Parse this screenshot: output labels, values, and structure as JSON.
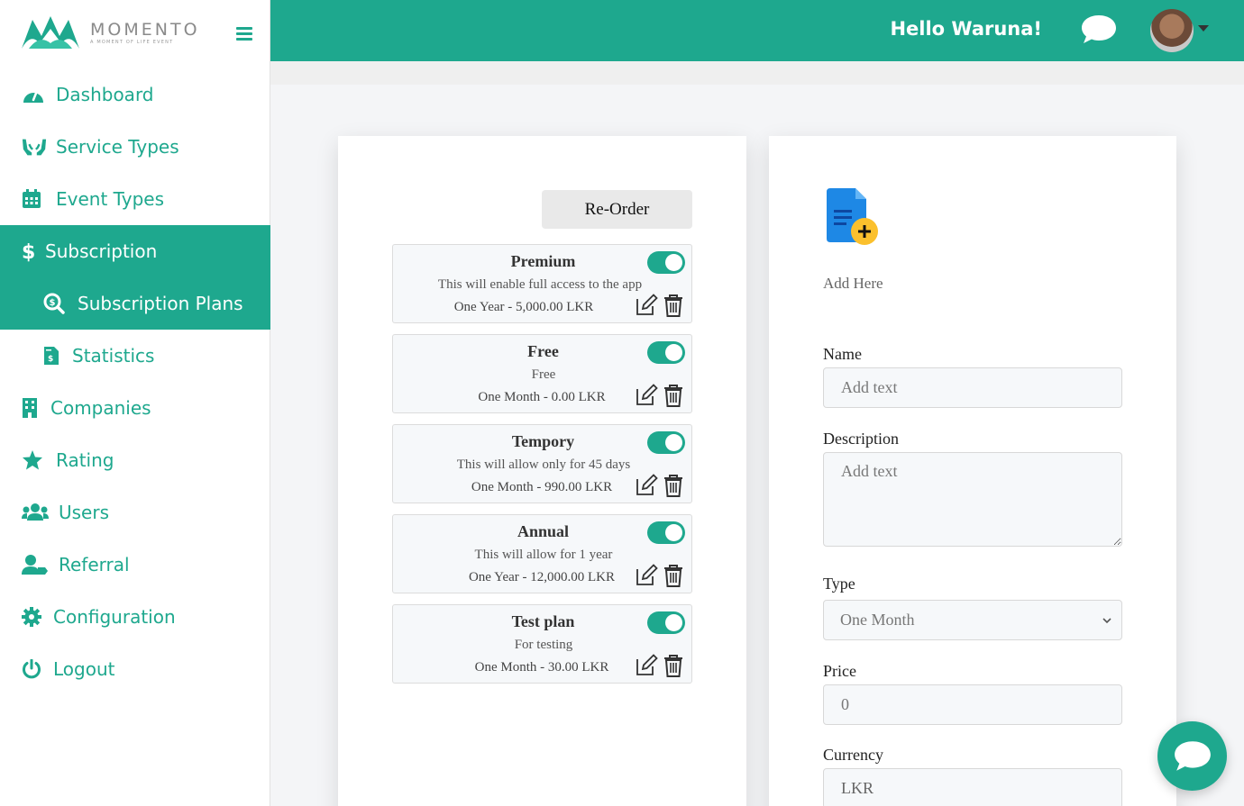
{
  "brand": {
    "name": "MOMENTO",
    "tagline": "A MOMENT OF LIFE EVENT"
  },
  "header": {
    "greeting": "Hello Waruna!"
  },
  "sidebar": {
    "items": [
      {
        "label": "Dashboard",
        "icon": "dashboard-icon"
      },
      {
        "label": "Service Types",
        "icon": "hands-icon"
      },
      {
        "label": "Event Types",
        "icon": "calendar-icon"
      },
      {
        "label": "Subscription",
        "icon": "dollar-icon"
      },
      {
        "label": "Subscription Plans",
        "icon": "search-dollar-icon"
      },
      {
        "label": "Statistics",
        "icon": "invoice-icon"
      },
      {
        "label": "Companies",
        "icon": "building-icon"
      },
      {
        "label": "Rating",
        "icon": "star-icon"
      },
      {
        "label": "Users",
        "icon": "users-icon"
      },
      {
        "label": "Referral",
        "icon": "user-tag-icon"
      },
      {
        "label": "Configuration",
        "icon": "gear-icon"
      },
      {
        "label": "Logout",
        "icon": "power-icon"
      }
    ]
  },
  "plans_panel": {
    "reorder_label": "Re-Order",
    "plans": [
      {
        "name": "Premium",
        "description": "This will enable full access to the app",
        "price": "One Year - 5,000.00 LKR",
        "enabled": true
      },
      {
        "name": "Free",
        "description": "Free",
        "price": "One Month - 0.00 LKR",
        "enabled": true
      },
      {
        "name": "Tempory",
        "description": "This will allow only for 45 days",
        "price": "One Month - 990.00 LKR",
        "enabled": true
      },
      {
        "name": "Annual",
        "description": "This will allow for 1 year",
        "price": "One Year - 12,000.00 LKR",
        "enabled": true
      },
      {
        "name": "Test plan",
        "description": "For testing",
        "price": "One Month - 30.00 LKR",
        "enabled": true
      }
    ]
  },
  "form": {
    "add_label": "Add Here",
    "name_label": "Name",
    "name_placeholder": "Add text",
    "description_label": "Description",
    "description_placeholder": "Add text",
    "type_label": "Type",
    "type_value": "One Month",
    "price_label": "Price",
    "price_placeholder": "0",
    "currency_label": "Currency",
    "currency_value": "LKR"
  },
  "colors": {
    "primary": "#1ea88e",
    "header_text": "#ffffff"
  }
}
